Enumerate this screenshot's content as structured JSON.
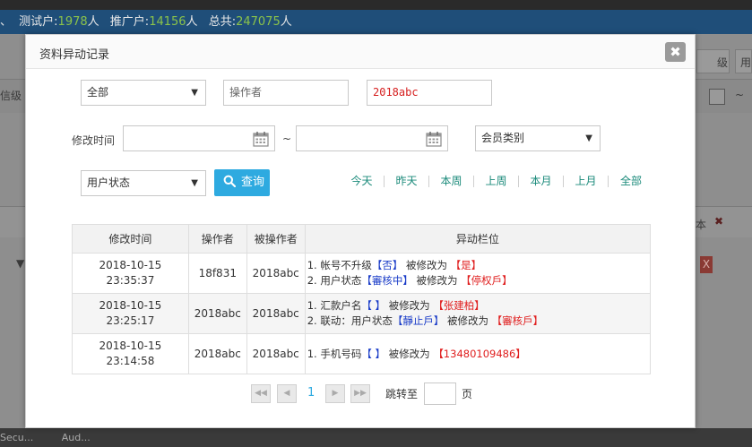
{
  "background": {
    "stats": {
      "prefix": "、",
      "test_label": "测试户:",
      "test_count": "1978",
      "test_unit": "人",
      "promo_label": "推广户:",
      "promo_count": "14156",
      "promo_unit": "人",
      "total_label": "总共:",
      "total_count": "247075",
      "total_unit": "人"
    },
    "right_select": "级",
    "right_select2": "用",
    "left_label": "信级",
    "right_header": "本",
    "delete_mark": "X",
    "footer_items": [
      "Secu...",
      "Aud..."
    ]
  },
  "modal": {
    "title": "资料异动记录",
    "close_glyph": "✖"
  },
  "filters": {
    "scope_select": "全部",
    "operator_placeholder": "操作者",
    "target_value": "2018abc",
    "modify_time_label": "修改时间",
    "range_sep": "~",
    "member_type_select": "会员类别",
    "user_status_select": "用户状态",
    "query_label": "查询"
  },
  "quick_ranges": [
    "今天",
    "昨天",
    "本周",
    "上周",
    "本月",
    "上月",
    "全部"
  ],
  "table": {
    "headers": [
      "修改时间",
      "操作者",
      "被操作者",
      "异动栏位"
    ],
    "rows": [
      {
        "date": "2018-10-15",
        "time": "23:35:37",
        "operator": "18f831",
        "target": "2018abc",
        "changes": [
          {
            "prefix": "1. 帐号不升级",
            "old": "【否】",
            "mid": " 被修改为 ",
            "new": "【是】"
          },
          {
            "prefix": "2. 用户状态",
            "old": "【審核中】",
            "mid": " 被修改为 ",
            "new": "【停权戶】"
          }
        ]
      },
      {
        "date": "2018-10-15",
        "time": "23:25:17",
        "operator": "2018abc",
        "target": "2018abc",
        "changes": [
          {
            "prefix": "1. 汇款户名",
            "old": "【 】",
            "mid": " 被修改为 ",
            "new": "【张建柏】"
          },
          {
            "prefix": "2. 联动：用户状态",
            "old": "【靜止戶】",
            "mid": " 被修改为 ",
            "new": "【審核戶】"
          }
        ]
      },
      {
        "date": "2018-10-15",
        "time": "23:14:58",
        "operator": "2018abc",
        "target": "2018abc",
        "changes": [
          {
            "prefix": "1. 手机号码",
            "old": "【 】",
            "mid": " 被修改为 ",
            "new": "【13480109486】"
          }
        ]
      }
    ]
  },
  "pager": {
    "first": "◀◀",
    "prev": "◀",
    "current_page": "1",
    "next": "▶",
    "last": "▶▶",
    "jump_label": "跳转至",
    "page_unit": "页"
  },
  "colors": {
    "accent": "#2eaae0",
    "link_teal": "#1a8a7a",
    "old_value_blue": "#1a3cc8",
    "new_value_red": "#e02020",
    "header_bar": "#1f4e79"
  }
}
